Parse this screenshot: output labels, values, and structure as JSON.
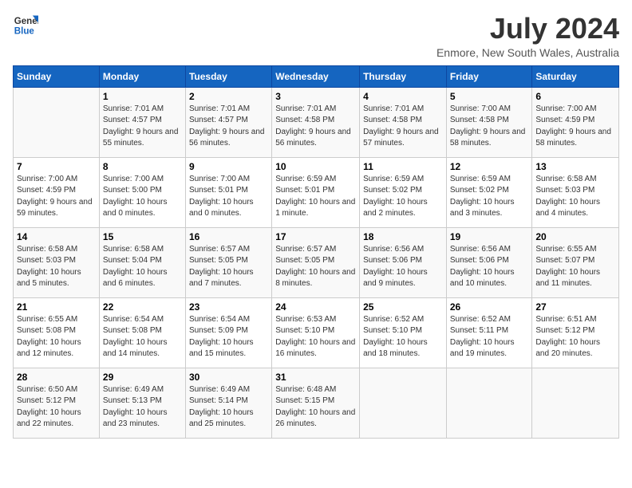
{
  "header": {
    "logo_general": "General",
    "logo_blue": "Blue",
    "month_year": "July 2024",
    "location": "Enmore, New South Wales, Australia"
  },
  "days_of_week": [
    "Sunday",
    "Monday",
    "Tuesday",
    "Wednesday",
    "Thursday",
    "Friday",
    "Saturday"
  ],
  "weeks": [
    [
      {
        "day": "",
        "sunrise": "",
        "sunset": "",
        "daylight": ""
      },
      {
        "day": "1",
        "sunrise": "Sunrise: 7:01 AM",
        "sunset": "Sunset: 4:57 PM",
        "daylight": "Daylight: 9 hours and 55 minutes."
      },
      {
        "day": "2",
        "sunrise": "Sunrise: 7:01 AM",
        "sunset": "Sunset: 4:57 PM",
        "daylight": "Daylight: 9 hours and 56 minutes."
      },
      {
        "day": "3",
        "sunrise": "Sunrise: 7:01 AM",
        "sunset": "Sunset: 4:58 PM",
        "daylight": "Daylight: 9 hours and 56 minutes."
      },
      {
        "day": "4",
        "sunrise": "Sunrise: 7:01 AM",
        "sunset": "Sunset: 4:58 PM",
        "daylight": "Daylight: 9 hours and 57 minutes."
      },
      {
        "day": "5",
        "sunrise": "Sunrise: 7:00 AM",
        "sunset": "Sunset: 4:58 PM",
        "daylight": "Daylight: 9 hours and 58 minutes."
      },
      {
        "day": "6",
        "sunrise": "Sunrise: 7:00 AM",
        "sunset": "Sunset: 4:59 PM",
        "daylight": "Daylight: 9 hours and 58 minutes."
      }
    ],
    [
      {
        "day": "7",
        "sunrise": "Sunrise: 7:00 AM",
        "sunset": "Sunset: 4:59 PM",
        "daylight": "Daylight: 9 hours and 59 minutes."
      },
      {
        "day": "8",
        "sunrise": "Sunrise: 7:00 AM",
        "sunset": "Sunset: 5:00 PM",
        "daylight": "Daylight: 10 hours and 0 minutes."
      },
      {
        "day": "9",
        "sunrise": "Sunrise: 7:00 AM",
        "sunset": "Sunset: 5:01 PM",
        "daylight": "Daylight: 10 hours and 0 minutes."
      },
      {
        "day": "10",
        "sunrise": "Sunrise: 6:59 AM",
        "sunset": "Sunset: 5:01 PM",
        "daylight": "Daylight: 10 hours and 1 minute."
      },
      {
        "day": "11",
        "sunrise": "Sunrise: 6:59 AM",
        "sunset": "Sunset: 5:02 PM",
        "daylight": "Daylight: 10 hours and 2 minutes."
      },
      {
        "day": "12",
        "sunrise": "Sunrise: 6:59 AM",
        "sunset": "Sunset: 5:02 PM",
        "daylight": "Daylight: 10 hours and 3 minutes."
      },
      {
        "day": "13",
        "sunrise": "Sunrise: 6:58 AM",
        "sunset": "Sunset: 5:03 PM",
        "daylight": "Daylight: 10 hours and 4 minutes."
      }
    ],
    [
      {
        "day": "14",
        "sunrise": "Sunrise: 6:58 AM",
        "sunset": "Sunset: 5:03 PM",
        "daylight": "Daylight: 10 hours and 5 minutes."
      },
      {
        "day": "15",
        "sunrise": "Sunrise: 6:58 AM",
        "sunset": "Sunset: 5:04 PM",
        "daylight": "Daylight: 10 hours and 6 minutes."
      },
      {
        "day": "16",
        "sunrise": "Sunrise: 6:57 AM",
        "sunset": "Sunset: 5:05 PM",
        "daylight": "Daylight: 10 hours and 7 minutes."
      },
      {
        "day": "17",
        "sunrise": "Sunrise: 6:57 AM",
        "sunset": "Sunset: 5:05 PM",
        "daylight": "Daylight: 10 hours and 8 minutes."
      },
      {
        "day": "18",
        "sunrise": "Sunrise: 6:56 AM",
        "sunset": "Sunset: 5:06 PM",
        "daylight": "Daylight: 10 hours and 9 minutes."
      },
      {
        "day": "19",
        "sunrise": "Sunrise: 6:56 AM",
        "sunset": "Sunset: 5:06 PM",
        "daylight": "Daylight: 10 hours and 10 minutes."
      },
      {
        "day": "20",
        "sunrise": "Sunrise: 6:55 AM",
        "sunset": "Sunset: 5:07 PM",
        "daylight": "Daylight: 10 hours and 11 minutes."
      }
    ],
    [
      {
        "day": "21",
        "sunrise": "Sunrise: 6:55 AM",
        "sunset": "Sunset: 5:08 PM",
        "daylight": "Daylight: 10 hours and 12 minutes."
      },
      {
        "day": "22",
        "sunrise": "Sunrise: 6:54 AM",
        "sunset": "Sunset: 5:08 PM",
        "daylight": "Daylight: 10 hours and 14 minutes."
      },
      {
        "day": "23",
        "sunrise": "Sunrise: 6:54 AM",
        "sunset": "Sunset: 5:09 PM",
        "daylight": "Daylight: 10 hours and 15 minutes."
      },
      {
        "day": "24",
        "sunrise": "Sunrise: 6:53 AM",
        "sunset": "Sunset: 5:10 PM",
        "daylight": "Daylight: 10 hours and 16 minutes."
      },
      {
        "day": "25",
        "sunrise": "Sunrise: 6:52 AM",
        "sunset": "Sunset: 5:10 PM",
        "daylight": "Daylight: 10 hours and 18 minutes."
      },
      {
        "day": "26",
        "sunrise": "Sunrise: 6:52 AM",
        "sunset": "Sunset: 5:11 PM",
        "daylight": "Daylight: 10 hours and 19 minutes."
      },
      {
        "day": "27",
        "sunrise": "Sunrise: 6:51 AM",
        "sunset": "Sunset: 5:12 PM",
        "daylight": "Daylight: 10 hours and 20 minutes."
      }
    ],
    [
      {
        "day": "28",
        "sunrise": "Sunrise: 6:50 AM",
        "sunset": "Sunset: 5:12 PM",
        "daylight": "Daylight: 10 hours and 22 minutes."
      },
      {
        "day": "29",
        "sunrise": "Sunrise: 6:49 AM",
        "sunset": "Sunset: 5:13 PM",
        "daylight": "Daylight: 10 hours and 23 minutes."
      },
      {
        "day": "30",
        "sunrise": "Sunrise: 6:49 AM",
        "sunset": "Sunset: 5:14 PM",
        "daylight": "Daylight: 10 hours and 25 minutes."
      },
      {
        "day": "31",
        "sunrise": "Sunrise: 6:48 AM",
        "sunset": "Sunset: 5:15 PM",
        "daylight": "Daylight: 10 hours and 26 minutes."
      },
      {
        "day": "",
        "sunrise": "",
        "sunset": "",
        "daylight": ""
      },
      {
        "day": "",
        "sunrise": "",
        "sunset": "",
        "daylight": ""
      },
      {
        "day": "",
        "sunrise": "",
        "sunset": "",
        "daylight": ""
      }
    ]
  ]
}
